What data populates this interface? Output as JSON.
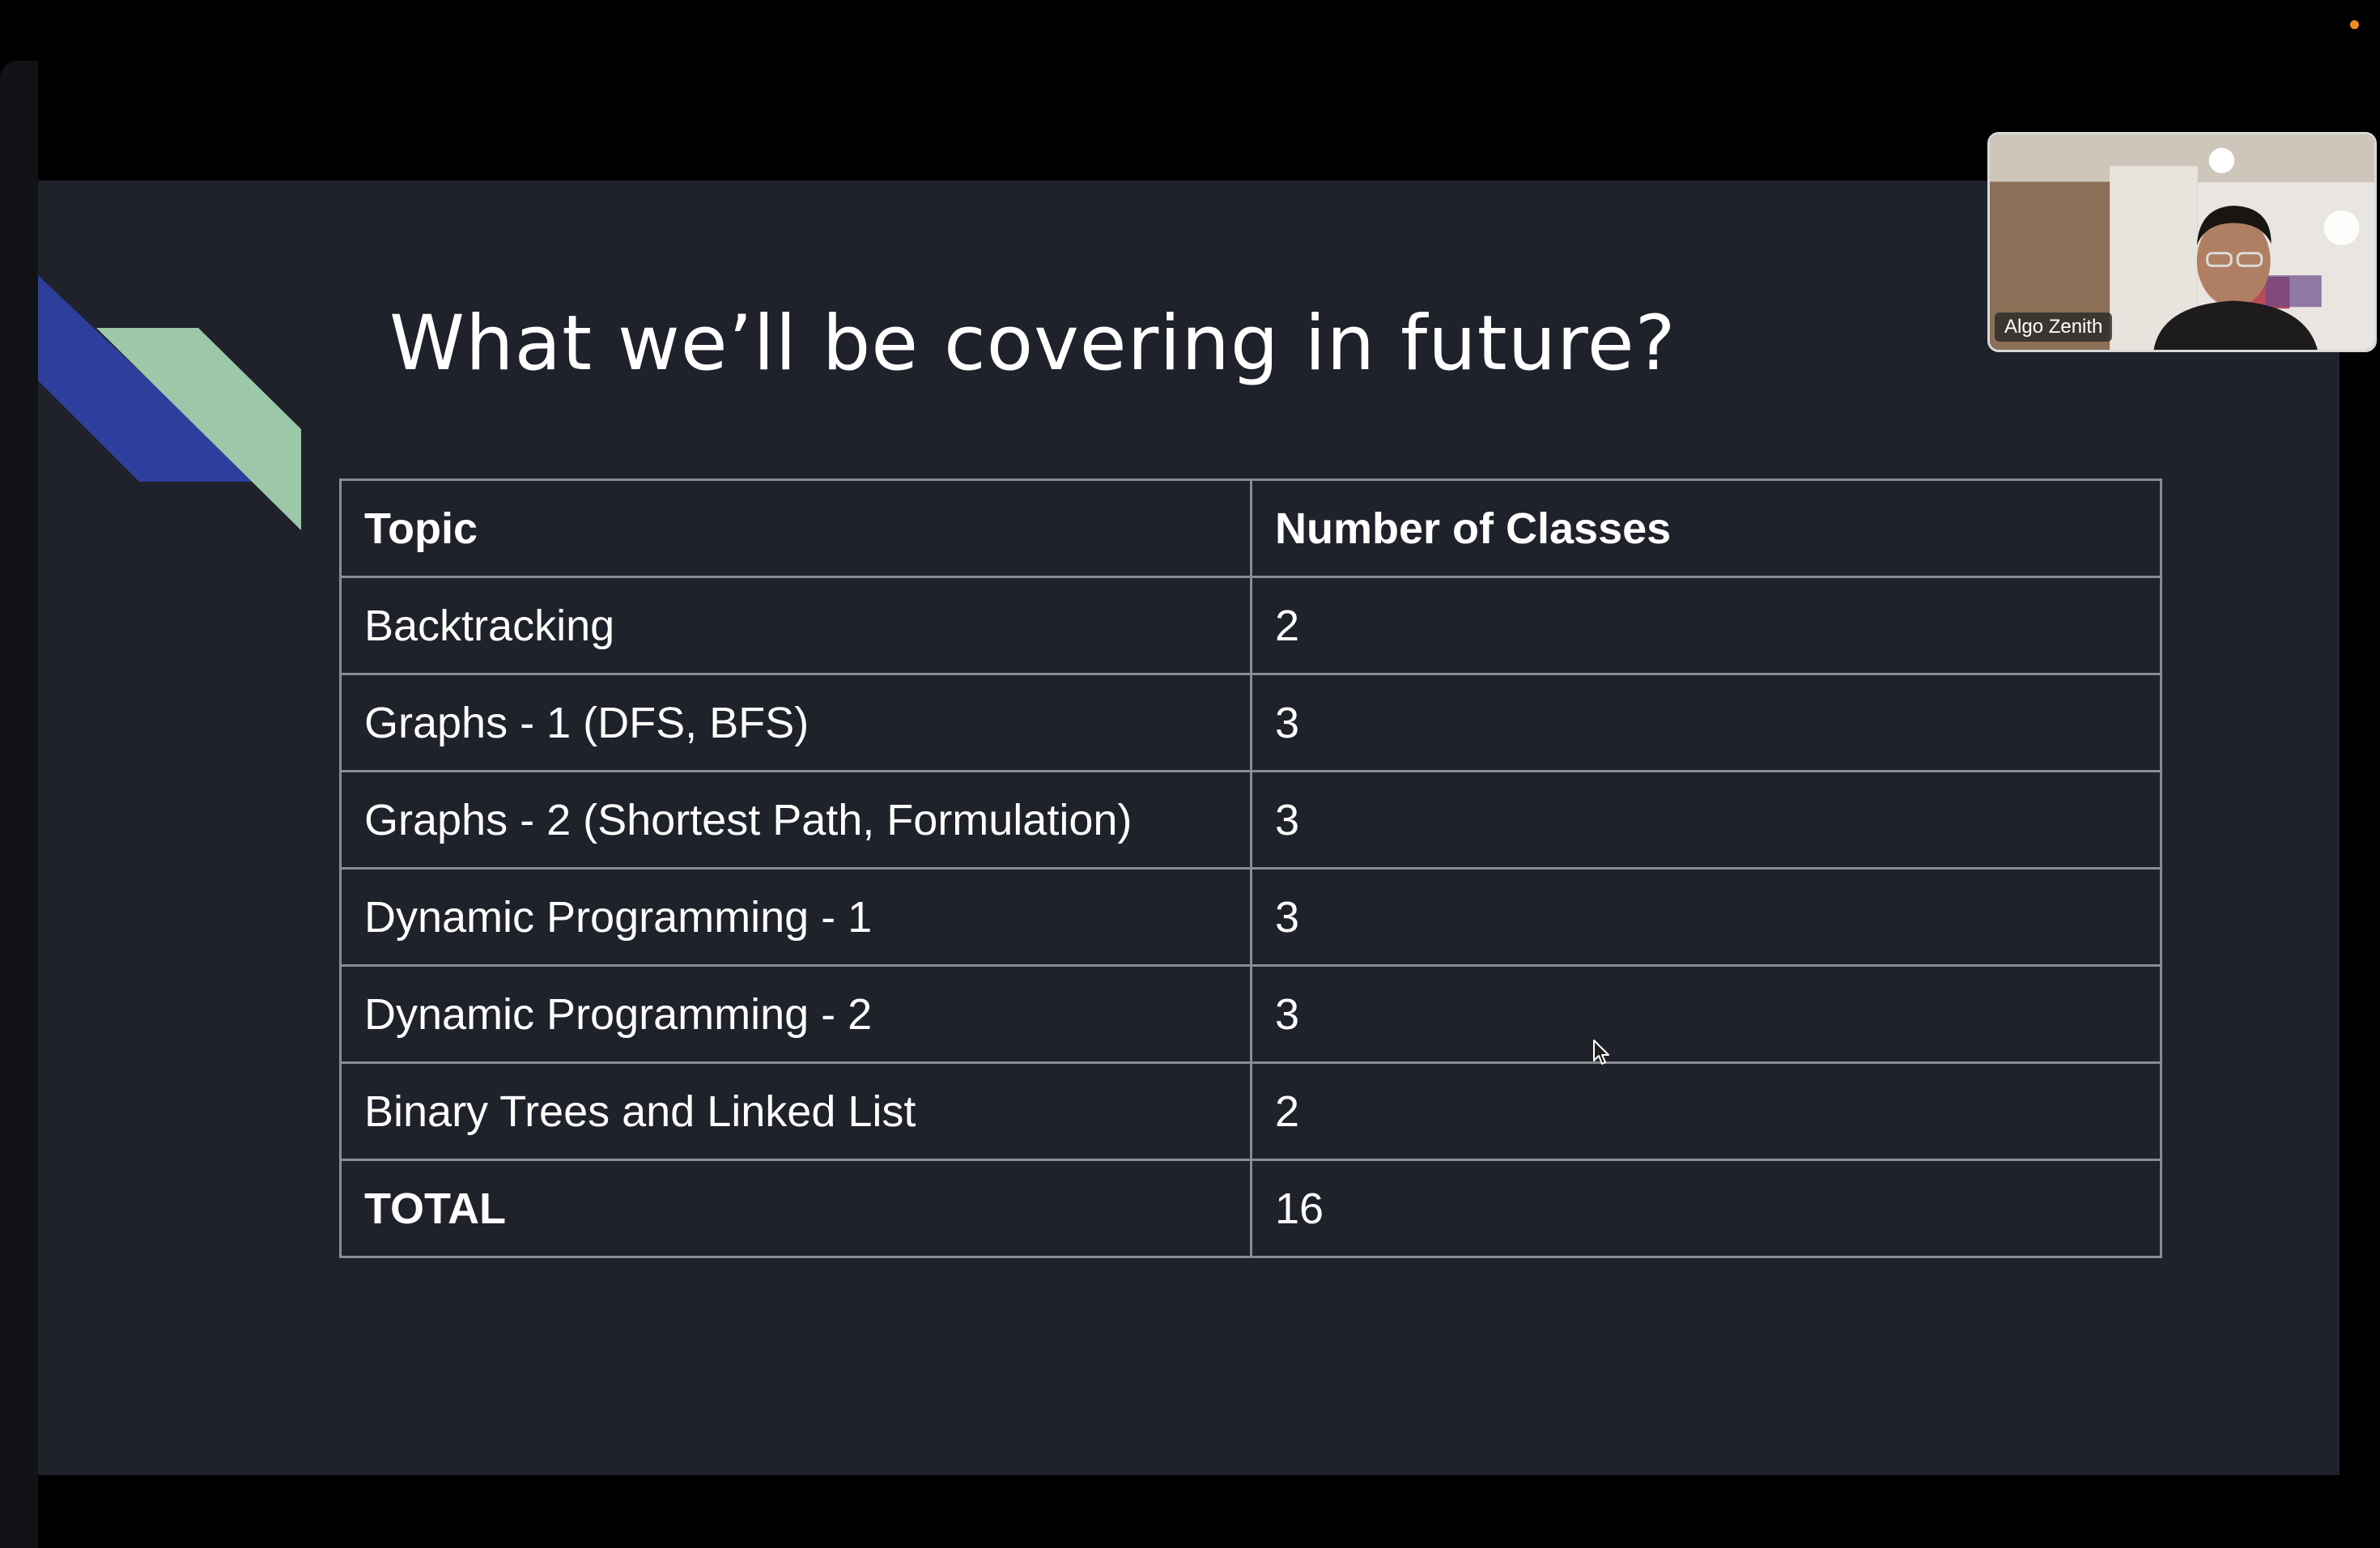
{
  "slide": {
    "title": "What we’ll be covering in future?",
    "table": {
      "headers": [
        "Topic",
        "Number of Classes"
      ],
      "rows": [
        [
          "Backtracking",
          "2"
        ],
        [
          "Graphs - 1 (DFS, BFS)",
          "3"
        ],
        [
          "Graphs - 2 (Shortest Path, Formulation)",
          "3"
        ],
        [
          "Dynamic Programming - 1",
          "3"
        ],
        [
          "Dynamic Programming - 2",
          "3"
        ],
        [
          "Binary Trees and Linked List",
          "2"
        ]
      ],
      "total": [
        "TOTAL",
        "16"
      ]
    }
  },
  "participant": {
    "name": "Algo Zenith"
  },
  "colors": {
    "slide_background": "#1f212b",
    "accent_blue": "#2e3e9c",
    "accent_green": "#9cc7a8",
    "status_dot": "#f08a24"
  }
}
